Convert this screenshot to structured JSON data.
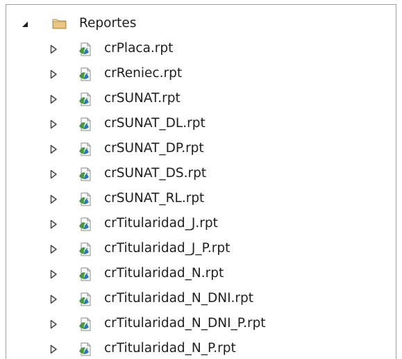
{
  "tree": {
    "root": {
      "label": "Reportes",
      "expanded": true,
      "icon": "folder-icon",
      "expander_icon": "expanded-triangle-icon"
    },
    "children": [
      {
        "label": "crPlaca.rpt",
        "icon": "crystal-report-icon"
      },
      {
        "label": "crReniec.rpt",
        "icon": "crystal-report-icon"
      },
      {
        "label": "crSUNAT.rpt",
        "icon": "crystal-report-icon"
      },
      {
        "label": "crSUNAT_DL.rpt",
        "icon": "crystal-report-icon"
      },
      {
        "label": "crSUNAT_DP.rpt",
        "icon": "crystal-report-icon"
      },
      {
        "label": "crSUNAT_DS.rpt",
        "icon": "crystal-report-icon"
      },
      {
        "label": "crSUNAT_RL.rpt",
        "icon": "crystal-report-icon"
      },
      {
        "label": "crTitularidad_J.rpt",
        "icon": "crystal-report-icon"
      },
      {
        "label": "crTitularidad_J_P.rpt",
        "icon": "crystal-report-icon"
      },
      {
        "label": "crTitularidad_N.rpt",
        "icon": "crystal-report-icon"
      },
      {
        "label": "crTitularidad_N_DNI.rpt",
        "icon": "crystal-report-icon"
      },
      {
        "label": "crTitularidad_N_DNI_P.rpt",
        "icon": "crystal-report-icon"
      },
      {
        "label": "crTitularidad_N_P.rpt",
        "icon": "crystal-report-icon"
      }
    ],
    "colors": {
      "border": "#a0a0a0",
      "text": "#1e1e1e",
      "folder": "#dcb67a",
      "report_green": "#3f9b3f",
      "report_blue": "#2f73c9"
    }
  }
}
